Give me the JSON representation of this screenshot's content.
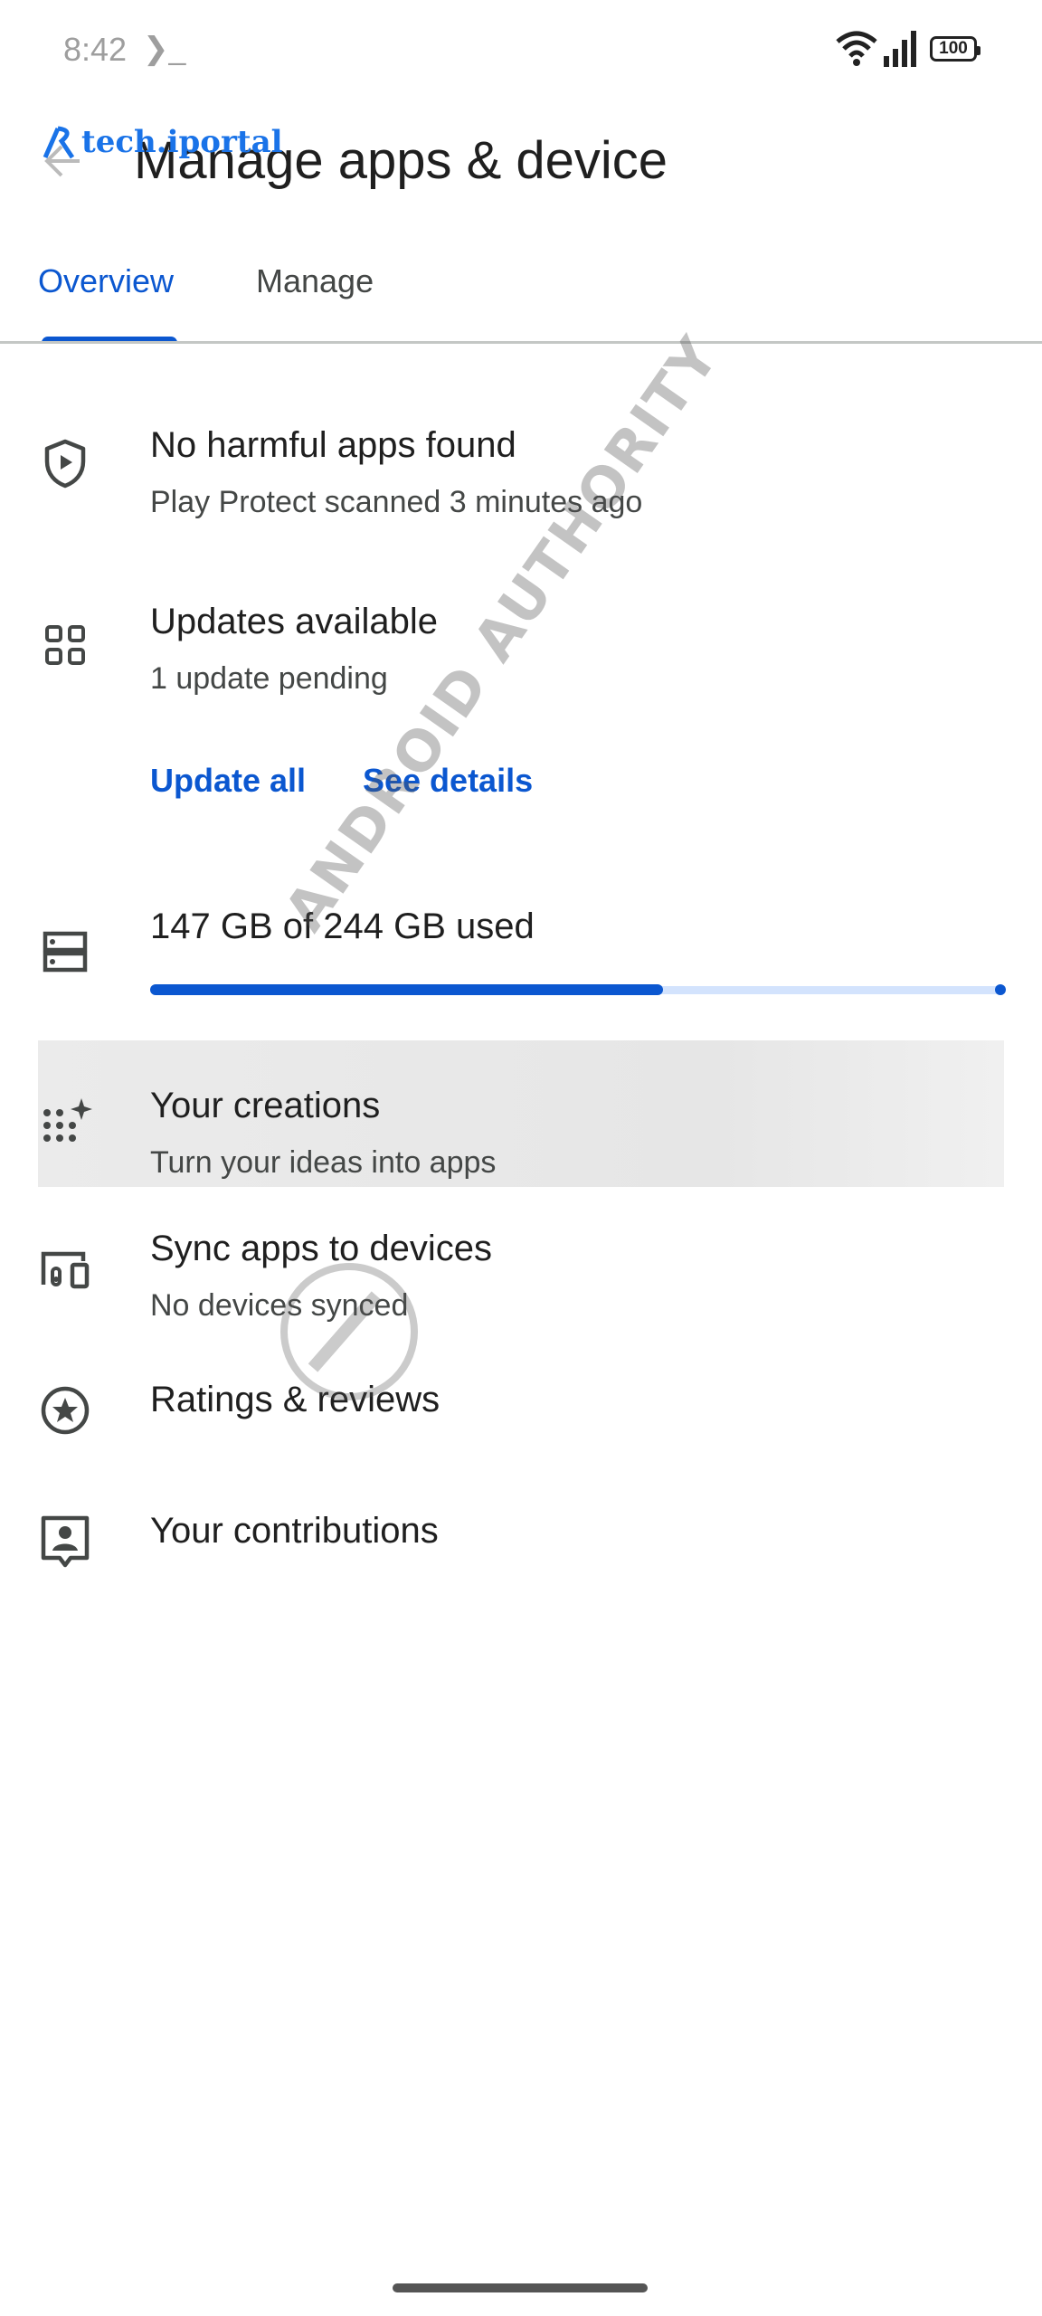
{
  "status_bar": {
    "time": "8:42",
    "terminal_glyph": "❯_",
    "battery": "100"
  },
  "header": {
    "title": "Manage apps & device",
    "logo_text": "tech.iportal"
  },
  "tabs": [
    {
      "label": "Overview",
      "selected": true
    },
    {
      "label": "Manage",
      "selected": false
    }
  ],
  "protect": {
    "title": "No harmful apps found",
    "subtitle": "Play Protect scanned 3 minutes ago",
    "icon": "shield-play-icon"
  },
  "updates": {
    "title": "Updates available",
    "subtitle": "1 update pending",
    "update_all": "Update all",
    "see_details": "See details",
    "icon": "apps-grid-icon"
  },
  "storage": {
    "label": "147 GB of 244 GB used",
    "used_fraction": 0.602,
    "icon": "storage-icon"
  },
  "creations": {
    "title": "Your creations",
    "subtitle": "Turn your ideas into apps",
    "icon": "sparkle-dots-icon"
  },
  "sync": {
    "title": "Sync apps to devices",
    "subtitle": "No devices synced",
    "icon": "devices-icon"
  },
  "ratings": {
    "title": "Ratings & reviews",
    "icon": "star-circle-icon"
  },
  "contributions": {
    "title": "Your contributions",
    "icon": "contributor-badge-icon"
  },
  "watermark": {
    "text": "ANDROID AUTHORITY"
  },
  "colors": {
    "accent": "#0b57d0",
    "text": "#1f1f1f",
    "secondary": "#444746",
    "logo": "#1a73e8"
  }
}
